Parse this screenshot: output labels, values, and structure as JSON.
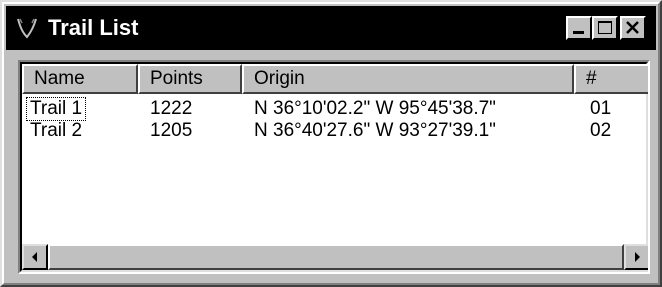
{
  "window": {
    "title": "Trail List",
    "app_icon": "trail-app-icon",
    "controls": {
      "minimize_icon": "minimize-icon",
      "maximize_icon": "maximize-icon",
      "close_icon": "close-icon"
    }
  },
  "list": {
    "columns": [
      "Name",
      "Points",
      "Origin",
      "#"
    ],
    "rows": [
      {
        "name": "Trail 1",
        "points": "1222",
        "origin": "N 36°10'02.2\" W  95°45'38.7\"",
        "num": "01",
        "focused": true
      },
      {
        "name": "Trail 2",
        "points": "1205",
        "origin": "N 36°40'27.6\" W  93°27'39.1\"",
        "num": "02",
        "focused": false
      }
    ]
  },
  "scrollbar": {
    "left_icon": "scroll-left-arrow-icon",
    "right_icon": "scroll-right-arrow-icon"
  },
  "colors": {
    "titlebar": "#000000",
    "face": "#c0c0c0",
    "list_bg": "#ffffff"
  }
}
